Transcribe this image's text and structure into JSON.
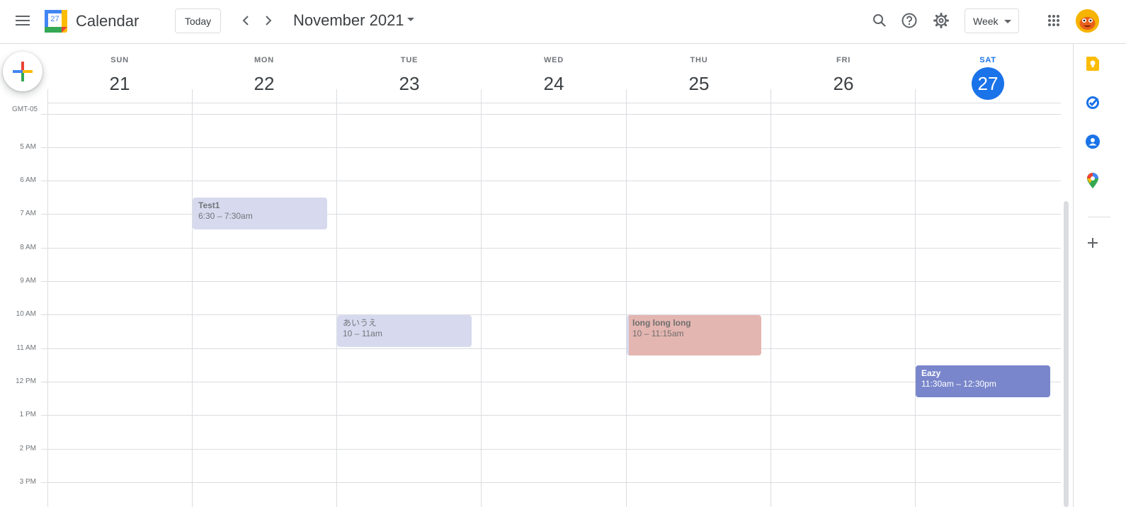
{
  "header": {
    "app_title": "Calendar",
    "logo_day": "27",
    "today_label": "Today",
    "month_title": "November 2021",
    "view_label": "Week"
  },
  "timezone": "GMT-05",
  "days": [
    {
      "dow": "SUN",
      "num": "21"
    },
    {
      "dow": "MON",
      "num": "22"
    },
    {
      "dow": "TUE",
      "num": "23"
    },
    {
      "dow": "WED",
      "num": "24"
    },
    {
      "dow": "THU",
      "num": "25"
    },
    {
      "dow": "FRI",
      "num": "26"
    },
    {
      "dow": "SAT",
      "num": "27",
      "today": true
    }
  ],
  "hours": [
    "5 AM",
    "6 AM",
    "7 AM",
    "8 AM",
    "9 AM",
    "10 AM",
    "11 AM",
    "12 PM",
    "1 PM",
    "2 PM",
    "3 PM"
  ],
  "events": [
    {
      "title": "Test1",
      "time": "6:30 – 7:30am"
    },
    {
      "title": "あいうえ",
      "time": "10 – 11am"
    },
    {
      "title": "long long long",
      "time": "10 – 11:15am"
    },
    {
      "title": "Eazy",
      "time": "11:30am – 12:30pm"
    }
  ],
  "colors": {
    "today_accent": "#1a73e8",
    "event_light": "#d7daee",
    "event_red": "#e4b6b1",
    "event_blue": "#7986cb"
  },
  "icons": {
    "menu": "hamburger-icon",
    "search": "search-icon",
    "help": "help-icon",
    "settings": "gear-icon",
    "apps": "apps-grid-icon",
    "side": [
      "keep-icon",
      "tasks-icon",
      "contacts-icon",
      "maps-icon",
      "add-icon"
    ]
  }
}
